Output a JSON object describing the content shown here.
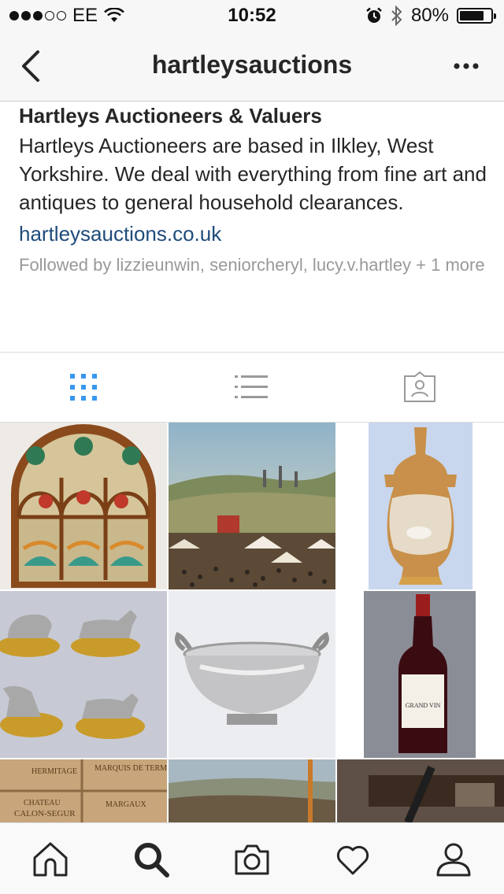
{
  "status_bar": {
    "carrier": "EE",
    "time": "10:52",
    "battery_percent": "80%",
    "battery_level": 0.8,
    "signal_bars_filled": 3,
    "signal_bars_total": 5,
    "icons": [
      "wifi-icon",
      "alarm-icon",
      "bluetooth-icon",
      "battery-icon"
    ]
  },
  "header": {
    "title": "hartleysauctions",
    "back_icon": "chevron-left-icon",
    "more_icon": "more-dots-icon"
  },
  "bio": {
    "name": "Hartleys Auctioneers & Valuers",
    "description": "Hartleys Auctioneers are based in Ilkley, West Yorkshire. We deal with everything from fine art and antiques to general household clearances.",
    "website": "hartleysauctions.co.uk",
    "followed_by": "Followed by lizzieunwin, seniorcheryl, lucy.v.hartley + 1 more"
  },
  "tabs": [
    {
      "name": "grid-view",
      "icon": "grid-icon",
      "active": true
    },
    {
      "name": "list-view",
      "icon": "list-icon",
      "active": false
    },
    {
      "name": "tagged",
      "icon": "tagged-photo-icon",
      "active": false
    }
  ],
  "grid_posts": [
    {
      "subject": "stained glass fire screen"
    },
    {
      "subject": "fairground landscape painting"
    },
    {
      "subject": "porcelain vase with sheep"
    },
    {
      "subject": "silver dog figures"
    },
    {
      "subject": "silver two-handled bowl"
    },
    {
      "subject": "bottle of red wine"
    },
    {
      "subject": "wooden wine cases"
    },
    {
      "subject": "landscape painting"
    },
    {
      "subject": "antique furniture"
    }
  ],
  "wine_label": "GRAND VIN",
  "crate_texts": [
    "HERMITAGE",
    "MARQUIS DE TERME",
    "CHATEAU",
    "CALON-SEGUR",
    "MARGAUX"
  ],
  "bottom_nav": [
    {
      "name": "home",
      "icon": "home-icon"
    },
    {
      "name": "search",
      "icon": "search-icon",
      "active": true
    },
    {
      "name": "camera",
      "icon": "camera-icon"
    },
    {
      "name": "activity",
      "icon": "heart-icon"
    },
    {
      "name": "profile",
      "icon": "profile-icon"
    }
  ],
  "colors": {
    "link": "#1f4b7a",
    "active_tab": "#3897f0",
    "inactive_icon": "#999999",
    "text": "#262626"
  }
}
